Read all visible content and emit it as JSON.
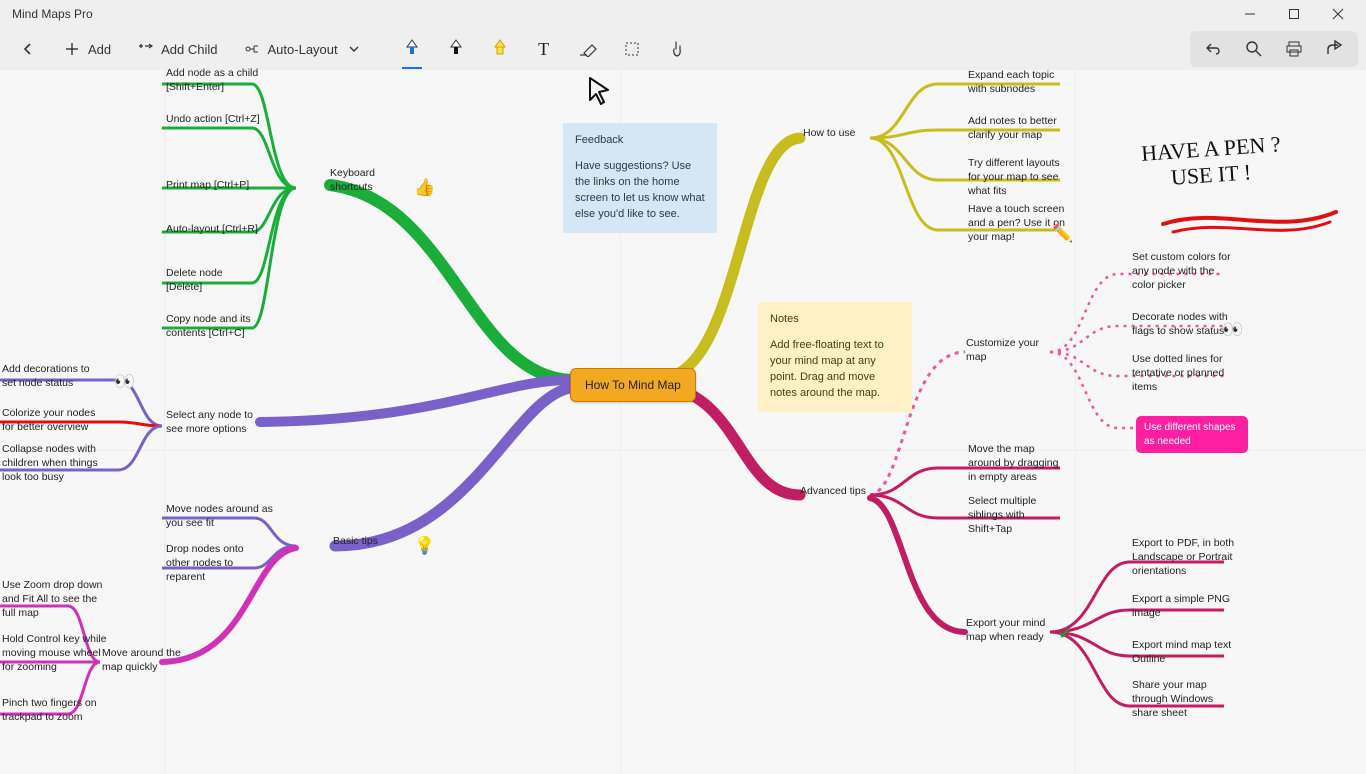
{
  "app": {
    "title": "Mind Maps Pro"
  },
  "toolbar": {
    "back": "Back",
    "add": "Add",
    "add_child": "Add Child",
    "auto_layout": "Auto-Layout",
    "undo": "Undo",
    "search": "Search",
    "print": "Print",
    "share": "Share"
  },
  "tools": {
    "pen_blue": "Blue pen",
    "pen_black": "Black pen",
    "highlighter": "Highlighter",
    "text": "Text",
    "eraser": "Eraser",
    "crop": "Selection",
    "pointer": "Touch"
  },
  "central": "How To Mind Map",
  "sticky_feedback": {
    "title": "Feedback",
    "body": "Have suggestions? Use the links on the home screen to let us know what else you'd like to see."
  },
  "sticky_notes": {
    "title": "Notes",
    "body": "Add free-floating text to your mind map at any point. Drag and move notes around the map."
  },
  "handwriting": {
    "line1": "HAVE A PEN ?",
    "line2": "USE IT !"
  },
  "branches": {
    "keyboard": {
      "label": "Keyboard shortcuts",
      "children": [
        "Add node as a child [Shift+Enter]",
        "Undo action [Ctrl+Z]",
        "Print map [Ctrl+P]",
        "Auto-layout [Ctrl+R]",
        "Delete node [Delete]",
        "Copy node and its contents [Ctrl+C]"
      ]
    },
    "see_more": {
      "label": "Select any node to see more options",
      "children": [
        "Add decorations to set node status",
        "Colorize your nodes for better overview",
        "Collapse nodes with children when things look too busy"
      ]
    },
    "basic": {
      "label": "Basic tips",
      "children": [
        "Move nodes around as you see fit",
        "Drop nodes onto other nodes to reparent"
      ]
    },
    "move": {
      "label": "Move around the map quickly",
      "children": [
        "Use Zoom drop down and Fit All to see the full map",
        "Hold Control key while moving mouse wheel for zooming",
        "Pinch two fingers on trackpad to zoom"
      ]
    },
    "howuse": {
      "label": "How to use",
      "children": [
        "Expand each topic with subnodes",
        "Add notes to better clarify your map",
        "Try different layouts for your map to see what fits",
        "Have a touch screen and a pen? Use it on your map!"
      ]
    },
    "customize": {
      "label": "Customize your map",
      "children": [
        "Set custom colors for any node with the color picker",
        "Decorate nodes with flags to show status",
        "Use dotted lines for tentative or planned items",
        "Use different shapes as needed"
      ]
    },
    "advanced": {
      "label": "Advanced tips",
      "children": [
        "Move the map around by dragging in empty areas",
        "Select multiple siblings with Shift+Tap"
      ]
    },
    "export": {
      "label": "Export your mind map when ready",
      "children": [
        "Export to PDF, in both Landscape or Portrait orientations",
        "Export a simple PNG image",
        "Export mind map text Outline",
        "Share your map through Windows share sheet"
      ]
    }
  }
}
